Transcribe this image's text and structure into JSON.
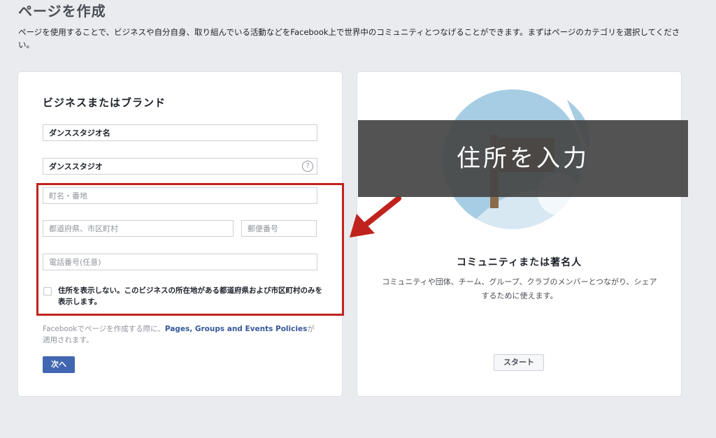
{
  "page": {
    "title": "ページを作成",
    "description": "ページを使用することで、ビジネスや自分自身、取り組んでいる活動などをFacebook上で世界中のコミュニティとつなげることができます。まずはページのカテゴリを選択してください。"
  },
  "business_card": {
    "heading": "ビジネスまたはブランド",
    "page_name_value": "ダンススタジオ名",
    "category_value": "ダンススタジオ",
    "help_icon_glyph": "?",
    "street_placeholder": "町名・番地",
    "city_placeholder": "都道府県、市区町村",
    "zip_placeholder": "郵便番号",
    "phone_placeholder": "電話番号(任意)",
    "hide_address_label": "住所を表示しない。このビジネスの所在地がある都道府県および市区町村のみを表示します。",
    "policy_prefix": "Facebookでページを作成する際に、",
    "policy_link": "Pages, Groups and Events Policies",
    "policy_suffix": "が適用されます。",
    "next_label": "次へ"
  },
  "community_card": {
    "heading": "コミュニティまたは著名人",
    "description": "コミュニティや団体、チーム、グループ、クラブのメンバーとつながり、シェアするために使えます。",
    "start_label": "スタート"
  },
  "overlay": {
    "text": "住所を入力"
  },
  "colors": {
    "highlight": "#c0231d",
    "primary_button": "#4267b2",
    "link": "#365899",
    "background": "#e9ebee"
  }
}
